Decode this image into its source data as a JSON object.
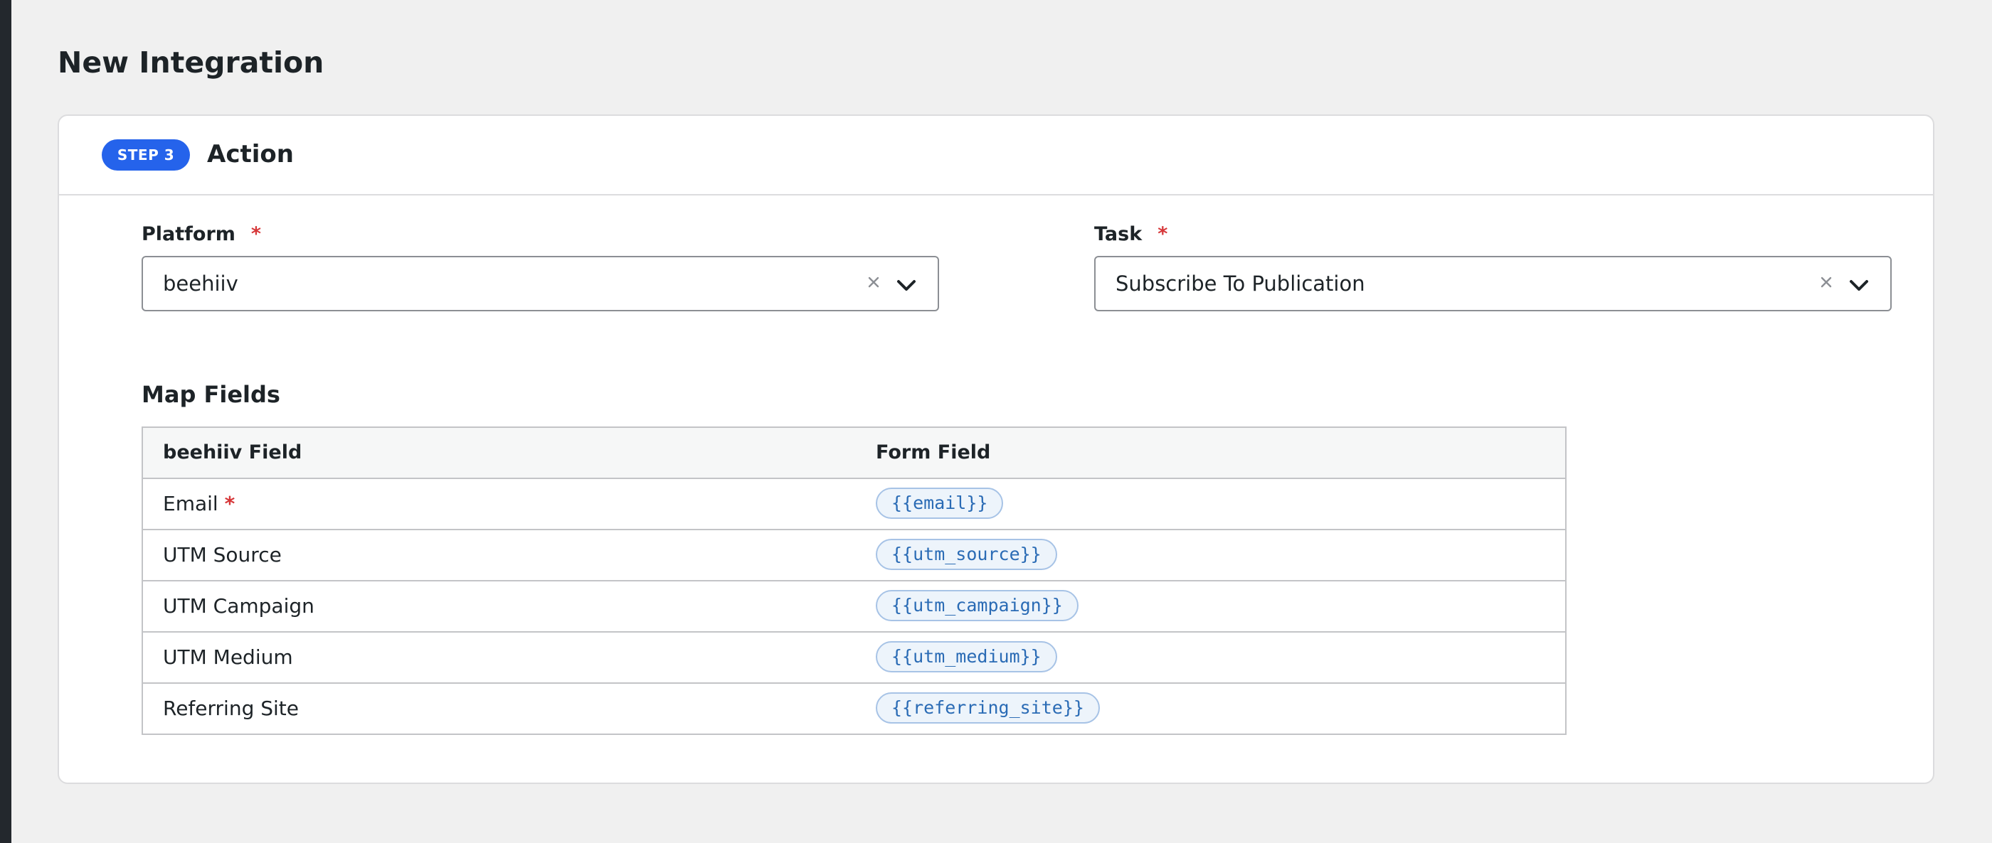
{
  "page": {
    "title": "New Integration"
  },
  "step": {
    "badge": "STEP 3",
    "title": "Action"
  },
  "platform": {
    "label": "Platform",
    "required_mark": "*",
    "value": "beehiiv",
    "clear_glyph": "×"
  },
  "task": {
    "label": "Task",
    "required_mark": "*",
    "value": "Subscribe To Publication",
    "clear_glyph": "×"
  },
  "map_fields": {
    "title": "Map Fields",
    "columns": [
      "beehiiv Field",
      "Form Field"
    ],
    "rows": [
      {
        "field": "Email",
        "required": "*",
        "token": "{{email}}"
      },
      {
        "field": "UTM Source",
        "required": "",
        "token": "{{utm_source}}"
      },
      {
        "field": "UTM Campaign",
        "required": "",
        "token": "{{utm_campaign}}"
      },
      {
        "field": "UTM Medium",
        "required": "",
        "token": "{{utm_medium}}"
      },
      {
        "field": "Referring Site",
        "required": "",
        "token": "{{referring_site}}"
      }
    ]
  },
  "icons": {
    "clear": "close-icon",
    "dropdown": "chevron-down-icon"
  },
  "colors": {
    "accent": "#2563eb",
    "required": "#d63638",
    "token_text": "#2a6bb5",
    "token_bg": "#edf4fb",
    "sidebar": "#23282d"
  }
}
